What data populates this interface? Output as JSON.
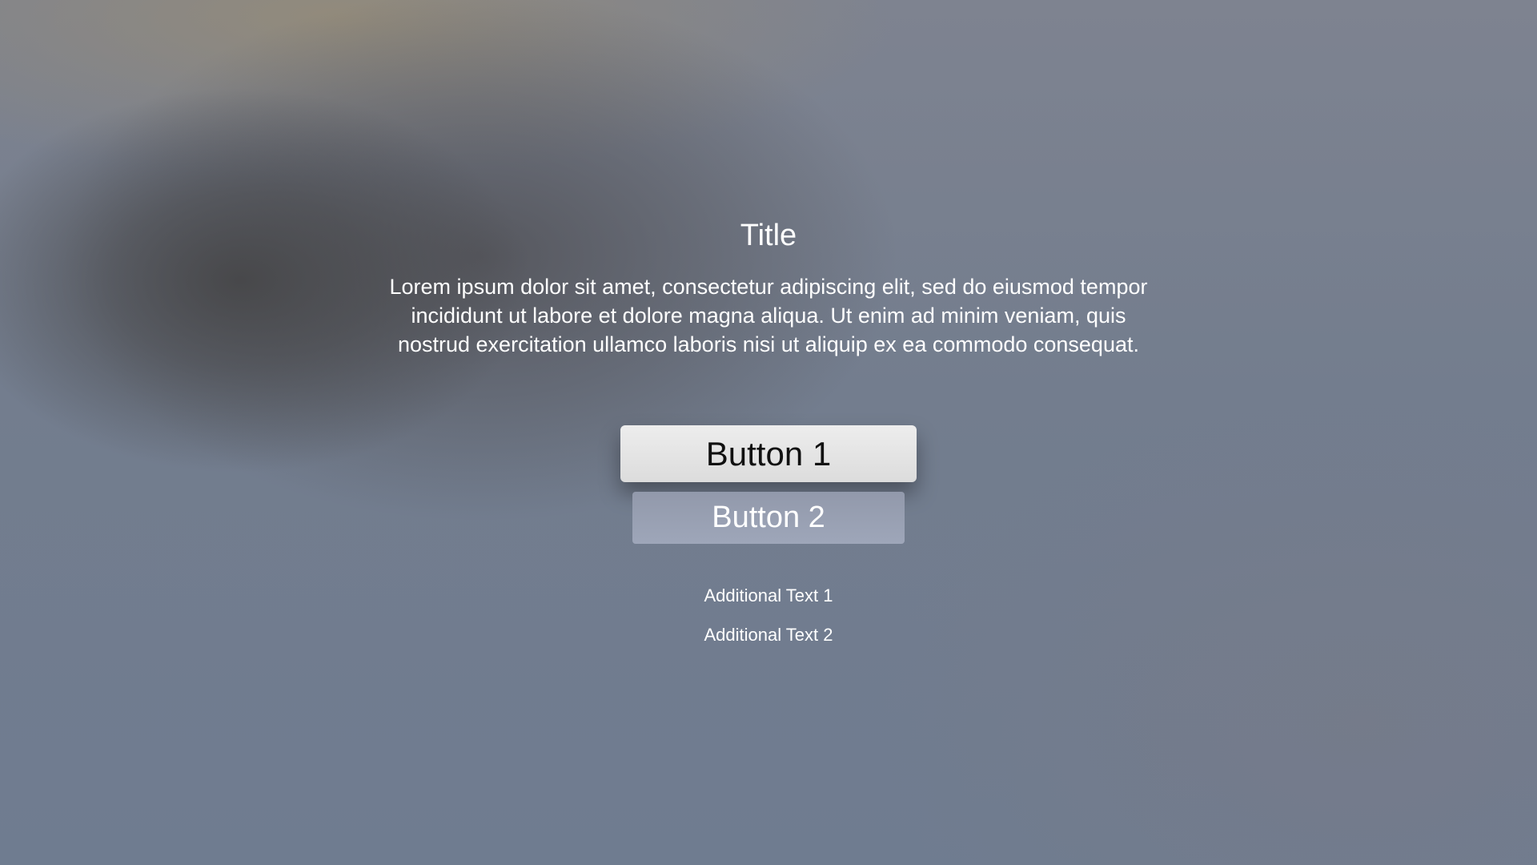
{
  "alert": {
    "title": "Title",
    "message": "Lorem ipsum dolor sit amet, consectetur adipiscing elit, sed do eiusmod tempor incididunt ut labore et dolore magna aliqua. Ut enim ad minim veniam, quis nostrud exercitation ullamco laboris nisi ut aliquip ex ea commodo consequat.",
    "buttons": [
      {
        "label": "Button 1",
        "state": "focused"
      },
      {
        "label": "Button 2",
        "state": "normal"
      }
    ],
    "additional_texts": [
      "Additional Text 1",
      "Additional Text 2"
    ]
  },
  "colors": {
    "focused_button_bg": "#e6e6e6",
    "normal_button_bg": "#989fb2",
    "text": "#ffffff"
  }
}
